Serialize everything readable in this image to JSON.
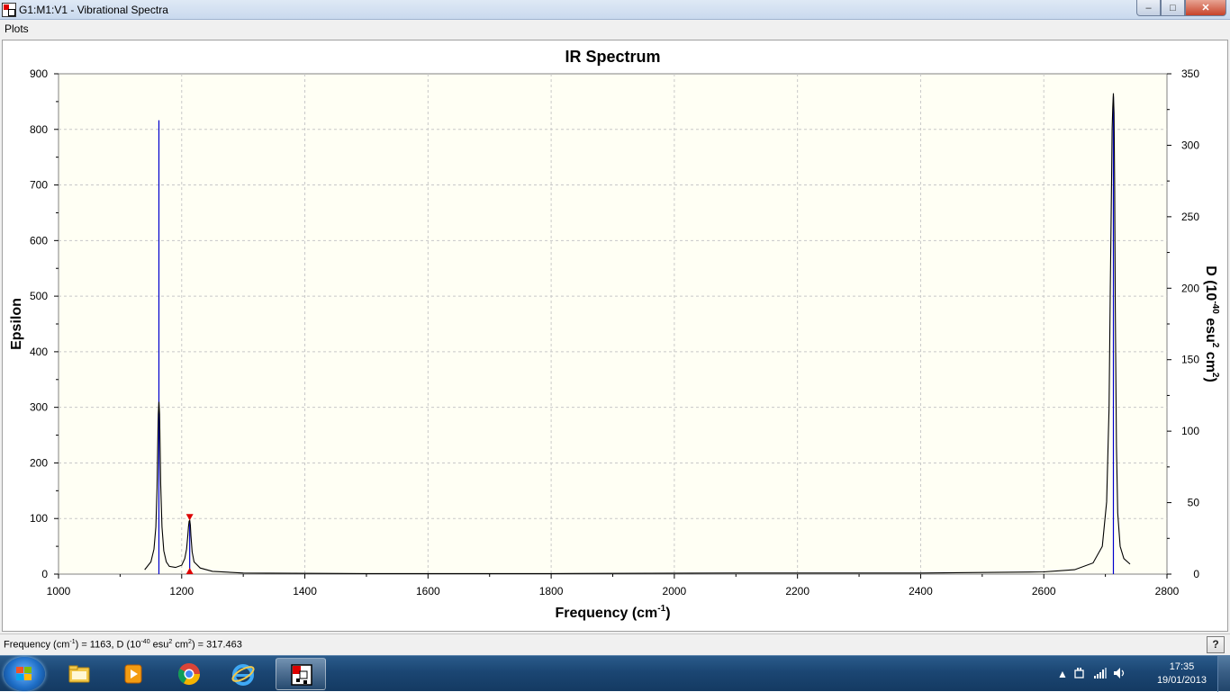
{
  "window": {
    "title": "G1:M1:V1 - Vibrational Spectra",
    "minimize_symbol": "–",
    "maximize_symbol": "□",
    "close_symbol": "✕"
  },
  "menu": {
    "items": [
      "Plots"
    ]
  },
  "status": {
    "freq_prefix": "Frequency (cm",
    "freq_exp": "-1",
    "freq_mid": ") = 1163, D (10",
    "d_exp": "-40",
    "d_mid": " esu",
    "esu_exp": "2",
    "cm_mid": " cm",
    "cm_exp": "2",
    "d_suffix": ") = 317.463",
    "help_label": "?"
  },
  "taskbar": {
    "time": "17:35",
    "date": "19/01/2013",
    "items": [
      "start-button",
      "file-explorer-icon",
      "media-player-icon",
      "chrome-icon",
      "internet-explorer-icon",
      "gaussview-icon"
    ]
  },
  "colors": {
    "plot_bg": "#fffff4",
    "grid": "#c8c8c8",
    "curve": "#000000",
    "stick": "#0000cc",
    "marker": "#dd0000"
  },
  "chart_data": {
    "type": "line",
    "title": "IR Spectrum",
    "xlabel": "Frequency (cm-1)",
    "ylabel": "Epsilon",
    "y2label": "D (10-40 esu2 cm2)",
    "xlim": [
      1000,
      2800
    ],
    "ylim": [
      0,
      900
    ],
    "y2lim": [
      0,
      350
    ],
    "xticks": [
      1000,
      1200,
      1400,
      1600,
      1800,
      2000,
      2200,
      2400,
      2600,
      2800
    ],
    "yticks": [
      0,
      100,
      200,
      300,
      400,
      500,
      600,
      700,
      800,
      900
    ],
    "y2ticks": [
      0,
      50,
      100,
      150,
      200,
      250,
      300,
      350
    ],
    "grid": true,
    "series": [
      {
        "kind": "curve",
        "x": [
          1140,
          1150,
          1155,
          1158,
          1160,
          1161,
          1162,
          1163,
          1164,
          1165,
          1166,
          1168,
          1171,
          1175,
          1180,
          1190,
          1200,
          1205,
          1208,
          1210,
          1211,
          1212,
          1213,
          1214,
          1215,
          1217,
          1220,
          1230,
          1250,
          1300,
          1500,
          1800,
          2100,
          2400,
          2600,
          2650,
          2680,
          2695,
          2702,
          2706,
          2708,
          2710,
          2711,
          2712,
          2713,
          2714,
          2715,
          2716,
          2718,
          2720,
          2724,
          2730,
          2740
        ],
        "y": [
          8,
          22,
          45,
          85,
          155,
          225,
          288,
          310,
          288,
          230,
          160,
          85,
          42,
          22,
          14,
          12,
          16,
          28,
          45,
          70,
          85,
          95,
          97,
          88,
          70,
          40,
          22,
          11,
          5,
          2,
          1,
          1,
          2,
          2,
          4,
          8,
          20,
          50,
          130,
          300,
          520,
          710,
          800,
          840,
          865,
          830,
          700,
          480,
          230,
          110,
          50,
          28,
          18
        ]
      },
      {
        "kind": "stick",
        "x": [
          1163,
          1213,
          2713
        ],
        "y": [
          317.463,
          37,
          334
        ]
      }
    ],
    "markers": [
      {
        "x": 1213,
        "shape": "triangle-down",
        "at": "top"
      },
      {
        "x": 1213,
        "shape": "triangle-up",
        "at": "bottom"
      }
    ]
  }
}
